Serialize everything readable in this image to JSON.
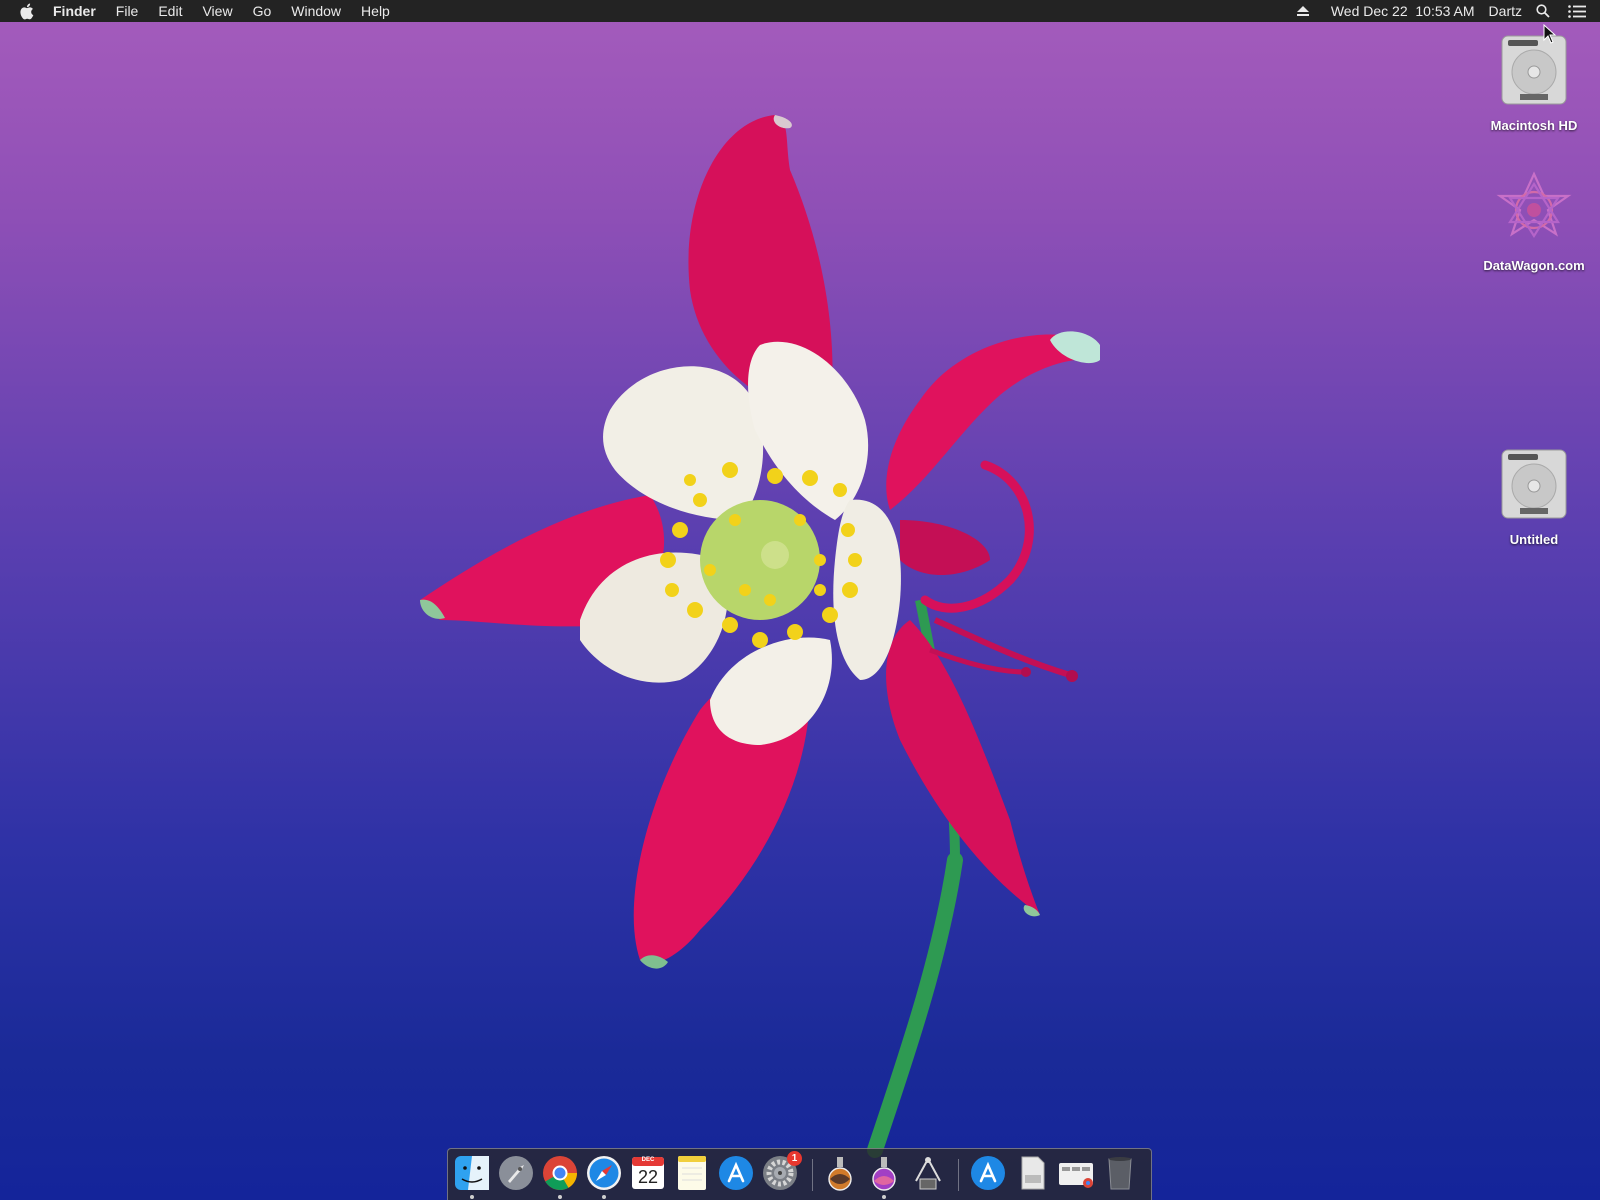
{
  "menubar": {
    "app_name": "Finder",
    "menus": [
      "File",
      "Edit",
      "View",
      "Go",
      "Window",
      "Help"
    ],
    "datetime": "Wed Dec 22  10:53 AM",
    "user": "Dartz",
    "icons": [
      "apple-icon",
      "eject-icon",
      "search-icon",
      "notification-center-icon"
    ]
  },
  "desktop": {
    "icons": [
      {
        "label": "Macintosh HD",
        "icon": "hard-drive-icon"
      },
      {
        "label": "DataWagon.com",
        "icon": "datawagon-icon"
      },
      {
        "label": "Untitled",
        "icon": "hard-drive-icon"
      }
    ]
  },
  "dock": {
    "calendar_month": "DEC",
    "calendar_day": "22",
    "system_preferences_badge": "1",
    "items": [
      "finder-icon",
      "launchpad-icon",
      "chrome-icon",
      "safari-icon",
      "calendar-icon",
      "notes-icon",
      "app-store-icon",
      "system-preferences-icon",
      "install-macos-icon",
      "install-macos-2-icon",
      "utility-icon",
      "app-store-2-icon",
      "document-icon",
      "chrome-folder-icon",
      "trash-icon"
    ]
  },
  "colors": {
    "menubar_bg": "#232323",
    "wallpaper_top": "#a55cbc",
    "wallpaper_bottom": "#14249a",
    "petal_red": "#e0125d",
    "petal_white": "#f2efe6",
    "stamen_yellow": "#f2d21a"
  }
}
